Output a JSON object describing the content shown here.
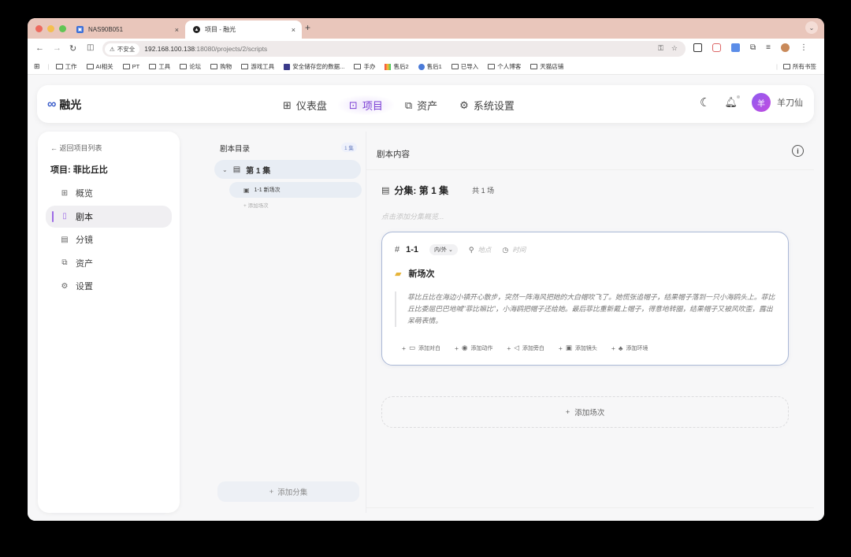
{
  "browser": {
    "tabs": [
      {
        "title": "NAS90B051",
        "close": "×",
        "active": false
      },
      {
        "title": "项目 - 融光",
        "close": "×",
        "active": true
      }
    ],
    "new_tab": "+",
    "win_menu": "⌄",
    "security": "不安全",
    "url_host": "192.168.100.138",
    "url_path": ":18080/projects/2/scripts",
    "bookmarks": [
      "工作",
      "AI相关",
      "PT",
      "工具",
      "论坛",
      "购物",
      "游戏工具",
      "安全储存您的数据...",
      "手办",
      "售后2",
      "售后1",
      "已导入",
      "个人博客",
      "天猫店铺"
    ],
    "all_bookmarks": "所有书签",
    "colors": {
      "tabstrip": "#e9c6bb",
      "close": "#ed6a5e",
      "min": "#f4bf4f",
      "max": "#61c554"
    }
  },
  "app": {
    "name": "融光",
    "nav": [
      {
        "label": "仪表盘",
        "icon": "grid-icon",
        "active": false
      },
      {
        "label": "项目",
        "icon": "folder-icon",
        "active": true
      },
      {
        "label": "资产",
        "icon": "images-icon",
        "active": false
      },
      {
        "label": "系统设置",
        "icon": "gear-icon",
        "active": false
      }
    ],
    "user": {
      "avatar_char": "羊",
      "name": "羊刀仙"
    },
    "accent": "#7b3fd4"
  },
  "sidebar": {
    "back": "返回项目列表",
    "project_title": "项目: 菲比丘比",
    "items": [
      {
        "label": "概览",
        "icon": "overview-icon",
        "active": false
      },
      {
        "label": "剧本",
        "icon": "book-icon",
        "active": true
      },
      {
        "label": "分镜",
        "icon": "film-icon",
        "active": false
      },
      {
        "label": "资产",
        "icon": "assets-icon",
        "active": false
      },
      {
        "label": "设置",
        "icon": "gear-icon",
        "active": false
      }
    ]
  },
  "tree": {
    "title": "剧本目录",
    "count": "1 集",
    "episode": "第 1 集",
    "scene": "1-1 新场次",
    "add_scene": "添加场次",
    "add_episode": "添加分集"
  },
  "content": {
    "title": "剧本内容",
    "episode_title": "分集: 第 1 集",
    "scene_count": "共 1 场",
    "synopsis_placeholder": "点击添加分集概览...",
    "card": {
      "number": "1-1",
      "inout": "内/外",
      "location_placeholder": "地点",
      "time_placeholder": "时间",
      "scene_title": "新场次",
      "description": "菲比丘比在海边小镇开心散步，突然一阵海风把她的大白帽吹飞了。她慌张追帽子，结果帽子落到一只小海鸥头上。菲比丘比委屈巴巴地喊\"菲比嘛比\"，小海鸥把帽子还给她。最后菲比重新戴上帽子，得意地转圈，结果帽子又被风吹歪，露出呆萌表情。",
      "actions": [
        {
          "label": "添加对白",
          "icon": "dialog-icon"
        },
        {
          "label": "添加动作",
          "icon": "eye-icon"
        },
        {
          "label": "添加旁白",
          "icon": "speaker-icon"
        },
        {
          "label": "添加镜头",
          "icon": "camera-icon"
        },
        {
          "label": "添加环境",
          "icon": "tree-icon"
        }
      ]
    },
    "add_scene": "添加场次"
  }
}
